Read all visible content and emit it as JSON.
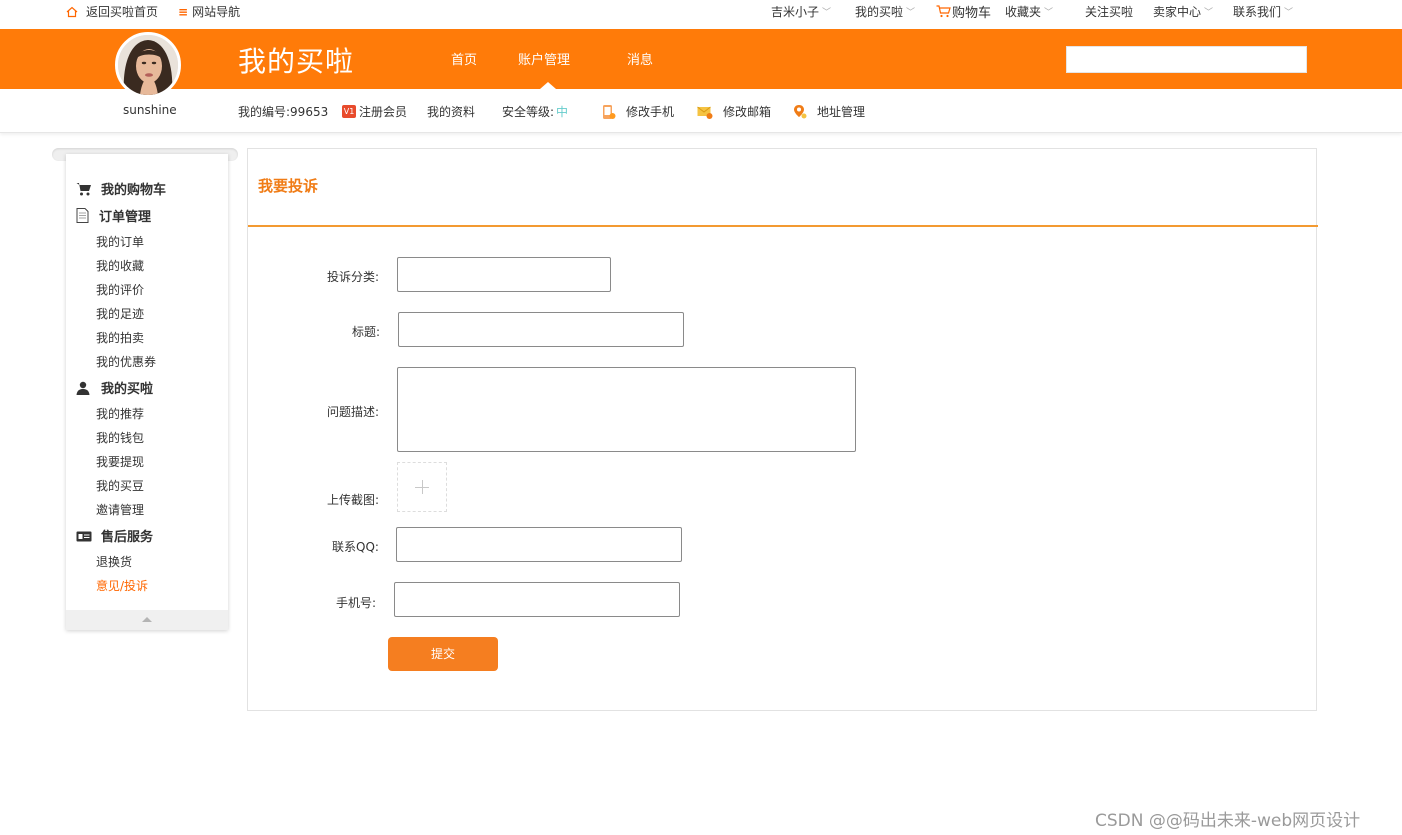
{
  "topbar": {
    "home": "返回买啦首页",
    "sitenav": "网站导航",
    "user": "吉米小子",
    "mymaila": "我的买啦",
    "cart": "购物车",
    "favorites": "收藏夹",
    "follow": "关注买啦",
    "seller": "卖家中心",
    "contact": "联系我们"
  },
  "header": {
    "brand": "我的买啦",
    "nav": [
      "首页",
      "账户管理",
      "消息"
    ],
    "search_placeholder": ""
  },
  "profile": {
    "username": "sunshine",
    "id_text": "我的编号:99653",
    "vip_badge": "V1",
    "member": "注册会员",
    "my_info": "我的资料",
    "security_label": "安全等级:",
    "security_level": "中",
    "edit_phone": "修改手机",
    "edit_email": "修改邮箱",
    "address": "地址管理"
  },
  "sidebar": {
    "groups": [
      {
        "title": "我的购物车",
        "icon": "cart-icon",
        "items": []
      },
      {
        "title": "订单管理",
        "icon": "document-icon",
        "items": [
          "我的订单",
          "我的收藏",
          "我的评价",
          "我的足迹",
          "我的拍卖",
          "我的优惠券"
        ]
      },
      {
        "title": "我的买啦",
        "icon": "person-icon",
        "items": [
          "我的推荐",
          "我的钱包",
          "我要提现",
          "我的买豆",
          "邀请管理"
        ]
      },
      {
        "title": "售后服务",
        "icon": "id-card-icon",
        "items": [
          "退换货",
          "意见/投诉"
        ]
      }
    ],
    "active_item": "意见/投诉"
  },
  "form": {
    "title": "我要投诉",
    "category_label": "投诉分类:",
    "subject_label": "标题:",
    "description_label": "问题描述:",
    "upload_label": "上传截图:",
    "qq_label": "联系QQ:",
    "phone_label": "手机号:",
    "submit": "提交"
  },
  "watermark": "CSDN @@码出未来-web网页设计",
  "colors": {
    "brand_orange": "#ff7b09",
    "accent_orange": "#f07c16",
    "button_orange": "#f57e20"
  }
}
